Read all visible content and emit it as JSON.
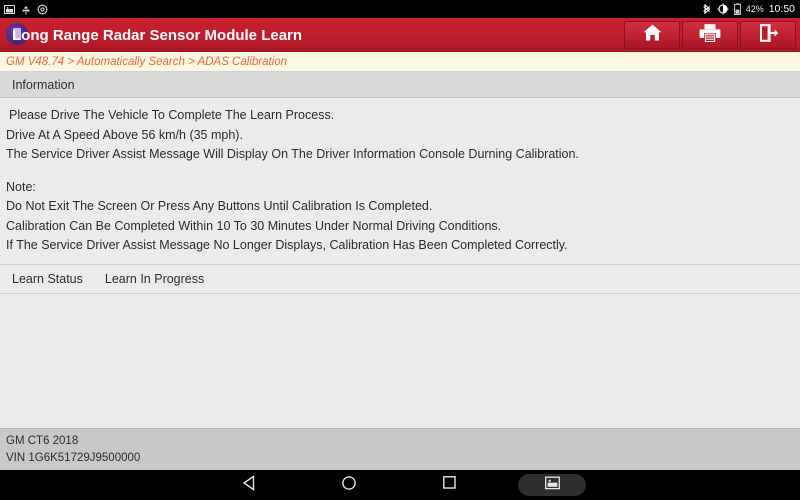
{
  "statusbar": {
    "left_icons": [
      "screenshot-icon",
      "usb-icon",
      "settings-icon"
    ],
    "right_icons": [
      "bluetooth-icon",
      "brightness-icon",
      "battery-icon"
    ],
    "battery_percent": "42%",
    "clock": "10:50"
  },
  "titlebar": {
    "app_title": "Long Range Radar Sensor Module Learn",
    "logo_name": "app-logo",
    "buttons": [
      {
        "name": "home-button",
        "icon": "home-icon"
      },
      {
        "name": "print-button",
        "icon": "printer-icon"
      },
      {
        "name": "exit-button",
        "icon": "exit-icon"
      }
    ],
    "colors": {
      "bar_top": "#c8202f",
      "bar_bottom": "#a81727",
      "button_border": "#8e1220"
    }
  },
  "breadcrumb": {
    "text": "GM V48.74 > Automatically Search > ADAS Calibration",
    "parts": [
      "GM V48.74",
      "Automatically Search",
      "ADAS Calibration"
    ],
    "separator": ">",
    "color": "#f0663c",
    "background": "#fdf8e3"
  },
  "section": {
    "header_title": "Information",
    "header_background": "#d9d9d9"
  },
  "information": {
    "lines_primary": [
      "Please Drive The Vehicle To Complete The Learn Process.",
      "Drive At A Speed Above 56 km/h (35 mph).",
      "The Service Driver Assist Message Will Display On The Driver Information Console Durning Calibration."
    ],
    "note_heading": "Note:",
    "lines_note": [
      "Do Not Exit The Screen Or Press Any Buttons Until Calibration Is Completed.",
      "Calibration Can Be Completed Within 10 To 30 Minutes Under Normal Driving Conditions.",
      "If The Service Driver Assist Message No Longer Displays, Calibration Has Been Completed Correctly."
    ]
  },
  "learn_status": {
    "label": "Learn Status",
    "value": "Learn In Progress"
  },
  "footer": {
    "vehicle": "GM CT6 2018",
    "vin": "VIN 1G6K51729J9500000",
    "background": "#c8c8c8"
  },
  "navbar": {
    "buttons": [
      {
        "name": "nav-back-button",
        "icon": "triangle-back-icon"
      },
      {
        "name": "nav-home-button",
        "icon": "circle-home-icon"
      },
      {
        "name": "nav-recents-button",
        "icon": "square-recents-icon"
      },
      {
        "name": "nav-screenshot-button",
        "icon": "screenshot-icon"
      }
    ],
    "active_button": "nav-screenshot-button"
  }
}
